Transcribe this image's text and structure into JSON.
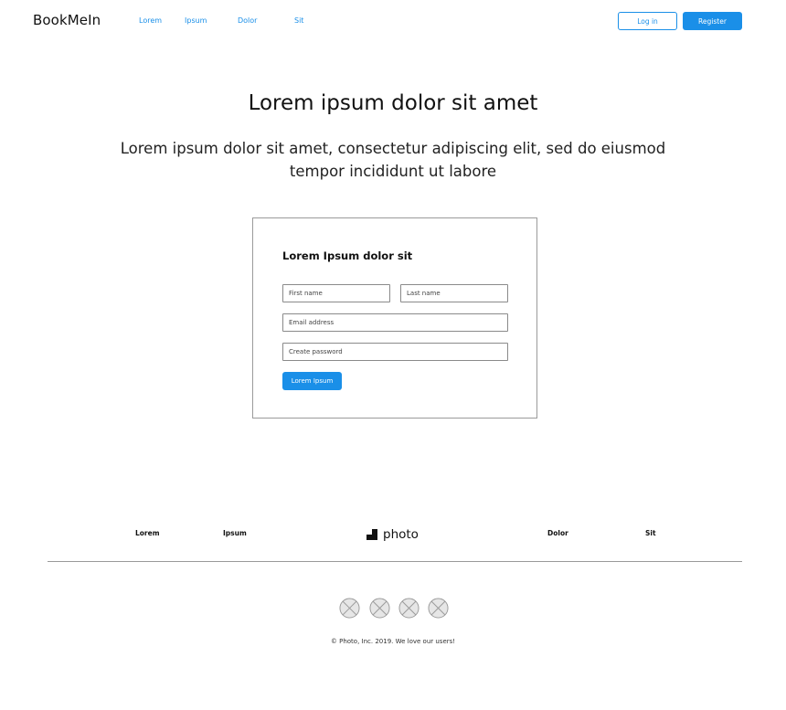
{
  "header": {
    "brand": "BookMeIn",
    "nav": [
      "Lorem",
      "Ipsum",
      "Dolor",
      "Sit"
    ],
    "login_label": "Log in",
    "register_label": "Register"
  },
  "hero": {
    "title": "Lorem ipsum dolor sit amet",
    "subtitle": "Lorem ipsum dolor sit amet, consectetur adipiscing elit, sed do eiusmod tempor incididunt ut labore"
  },
  "form": {
    "title": "Lorem Ipsum dolor sit",
    "first_name_placeholder": "First name",
    "last_name_placeholder": "Last name",
    "email_placeholder": "Email address",
    "password_placeholder": "Create password",
    "submit_label": "Lorem Ipsum"
  },
  "footer": {
    "links": [
      "Lorem",
      "Ipsum",
      "Dolor",
      "Sit"
    ],
    "logo_text": "photo",
    "social_icons": [
      "social-icon-placeholder",
      "social-icon-placeholder",
      "social-icon-placeholder",
      "social-icon-placeholder"
    ],
    "copyright": "© Photo, Inc. 2019. We love our users!"
  },
  "colors": {
    "accent": "#1a8fe8",
    "border": "#9a9a9a",
    "text": "#111111"
  }
}
